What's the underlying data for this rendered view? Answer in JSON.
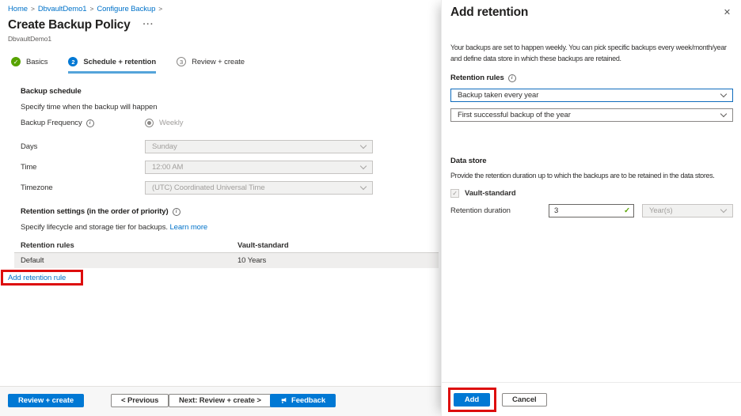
{
  "icons": {
    "check": "✓",
    "close": "✕",
    "info": "i",
    "ellipsis": "···"
  },
  "breadcrumb": {
    "sep": ">",
    "items": [
      "Home",
      "DbvaultDemo1",
      "Configure Backup"
    ]
  },
  "page": {
    "title": "Create Backup Policy",
    "subtitle": "DbvaultDemo1"
  },
  "tabs": [
    {
      "label": "Basics"
    },
    {
      "label": "Schedule + retention",
      "number": "2"
    },
    {
      "label": "Review + create",
      "number": "3"
    }
  ],
  "schedule": {
    "heading": "Backup schedule",
    "description": "Specify time when the backup will happen",
    "frequency_label": "Backup Frequency",
    "frequency_value": "Weekly",
    "days_label": "Days",
    "days_value": "Sunday",
    "time_label": "Time",
    "time_value": "12:00 AM",
    "timezone_label": "Timezone",
    "timezone_value": "(UTC) Coordinated Universal Time"
  },
  "retention": {
    "heading": "Retention settings (in the order of priority)",
    "description": "Specify lifecycle and storage tier for backups.",
    "learn_more": "Learn more",
    "col1": "Retention rules",
    "col2": "Vault-standard",
    "row1_name": "Default",
    "row1_value": "10 Years",
    "add_link": "Add retention rule"
  },
  "footer": {
    "review_create": "Review + create",
    "previous": "< Previous",
    "next": "Next: Review + create >",
    "feedback": "Feedback"
  },
  "panel": {
    "title": "Add retention",
    "description": "Your backups are set to happen weekly. You can pick specific backups every week/month/year and define data store in which these backups are retained.",
    "rules_heading": "Retention rules",
    "rule_dropdown1": "Backup taken every year",
    "rule_dropdown2": "First successful backup of the year",
    "datastore_heading": "Data store",
    "datastore_description": "Provide the retention duration up to which the backups are to be retained in the data stores.",
    "checkbox_label": "Vault-standard",
    "duration_label": "Retention duration",
    "duration_value": "3",
    "unit_value": "Year(s)",
    "add_button": "Add",
    "cancel_button": "Cancel"
  },
  "colors": {
    "accent": "#0078d4",
    "annotation": "#dd0d0d",
    "success": "#57a300"
  }
}
